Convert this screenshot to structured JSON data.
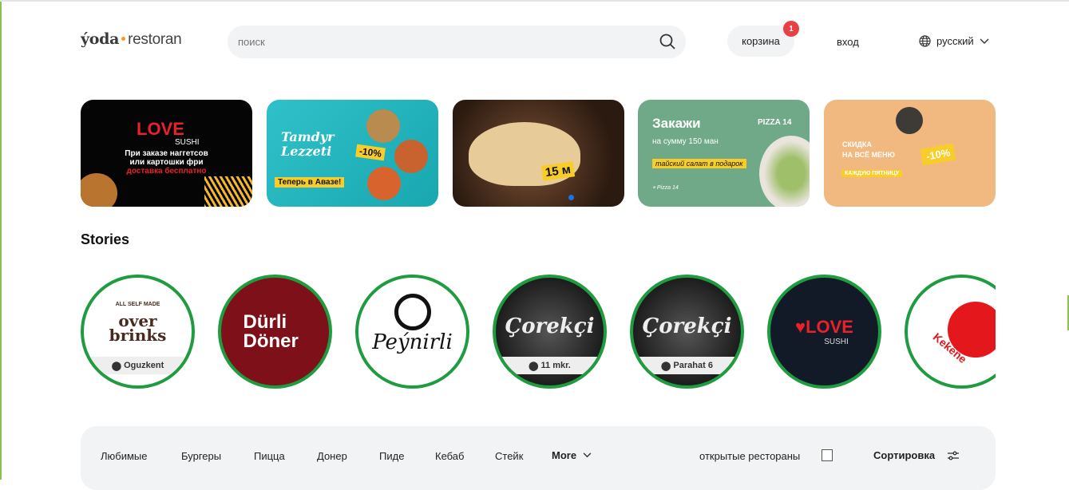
{
  "header": {
    "logo": {
      "part1": "ýoda",
      "part2": "restoran"
    },
    "search_placeholder": "поиск",
    "cart_label": "корзина",
    "cart_count": "1",
    "login_label": "вход",
    "language": "русский"
  },
  "banners": [
    {
      "brand": "LOVE",
      "sub": "SUSHI",
      "line1": "При заказе наггетсов",
      "line2": "или картошки фри",
      "line3": "доставка бесплатно"
    },
    {
      "brand": "Tamdyr Lezzeti",
      "discount": "-10%",
      "tag": "Теперь в Авазе!"
    },
    {
      "price": "15 м"
    },
    {
      "title": "Закажи",
      "sub": "на сумму 150 ман",
      "tag": "тайский салат в подарок",
      "brand": "PIZZA 14",
      "location": "Pizza 14"
    },
    {
      "line1": "СКИДКА",
      "line2": "НА ВСЁ МЕНЮ",
      "discount": "-10%",
      "tag": "КАЖДУЮ ПЯТНИЦУ"
    }
  ],
  "stories": {
    "title": "Stories",
    "items": [
      {
        "name": "over brinks",
        "top": "ALL SELF MADE",
        "location": "Oguzkent",
        "bg": "#ffffff",
        "color": "#4a2a1e"
      },
      {
        "name": "Dürli Döner",
        "bg": "#7d1018",
        "color": "#ffffff"
      },
      {
        "name": "Peýnirli",
        "bg": "#ffffff",
        "color": "#111111"
      },
      {
        "name": "Çorekçi",
        "location": "11 mkr.",
        "bg": "#2a2a2a",
        "color": "#eeeeee"
      },
      {
        "name": "Çorekçi",
        "location": "Parahat 6",
        "bg": "#2a2a2a",
        "color": "#eeeeee"
      },
      {
        "name": "LOVE",
        "sub": "SUSHI",
        "bg": "#111a26",
        "color": "#e8212a"
      },
      {
        "name": "Kekene",
        "bg": "#ffffff",
        "color": "#e0191e"
      }
    ]
  },
  "filters": {
    "categories": [
      "Любимые",
      "Бургеры",
      "Пицца",
      "Донер",
      "Пиде",
      "Кебаб",
      "Стейк"
    ],
    "more": "More",
    "open_label": "открытые рестораны",
    "open_checked": false,
    "sort_label": "Сортировка"
  },
  "colors": {
    "accent": "#1f9c3f",
    "badge": "#e94046",
    "logo_dot": "#f39a2b"
  }
}
